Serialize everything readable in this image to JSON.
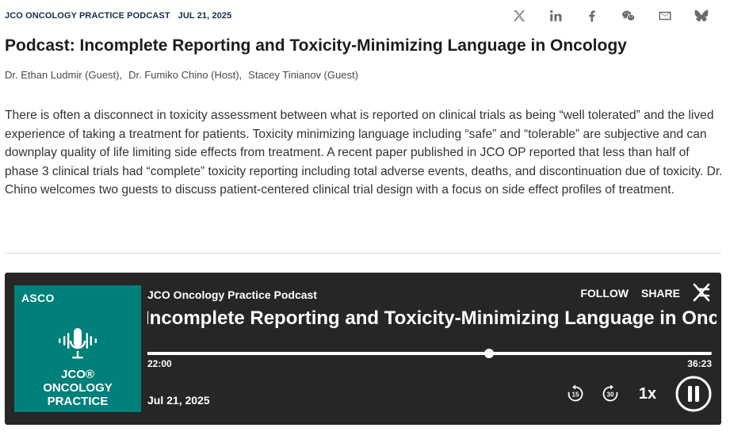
{
  "header": {
    "podcast_label": "JCO ONCOLOGY PRACTICE PODCAST",
    "date": "JUL 21, 2025"
  },
  "share_icons": [
    "x-icon",
    "linkedin-icon",
    "facebook-icon",
    "wechat-icon",
    "email-icon",
    "bluesky-icon"
  ],
  "article": {
    "title": "Podcast: Incomplete Reporting and Toxicity-Minimizing Language in Oncology",
    "authors": [
      "Dr. Ethan Ludmir (Guest),",
      "Dr. Fumiko Chino (Host),",
      "Stacey Tinianov (Guest)"
    ],
    "summary": "There is often a disconnect in toxicity assessment between what is reported on clinical trials as being “well tolerated” and the lived experience of taking a treatment for patients. Toxicity minimizing language including “safe” and “tolerable” are subjective and can downplay quality of life limiting side effects from treatment. A recent paper published in JCO OP reported that less than half of phase 3 clinical trials had “complete” toxicity reporting including total adverse events, deaths, and discontinuation due of toxicity. Dr. Chino welcomes two guests to discuss patient-centered clinical trial design with a focus on side effect profiles of treatment."
  },
  "player": {
    "cover": {
      "brand": "ASCO",
      "line1": "JCO®",
      "line2": "ONCOLOGY",
      "line3": "PRACTICE"
    },
    "show_name": "JCO Oncology Practice Podcast",
    "follow_label": "FOLLOW",
    "share_label": "SHARE",
    "episode_title": "Incomplete Reporting and Toxicity-Minimizing Language in Oncology",
    "elapsed": "22:00",
    "total": "36:23",
    "progress_fraction": 0.605,
    "publish_date": "Jul 21, 2025",
    "skip_back_seconds": "15",
    "skip_forward_seconds": "30",
    "speed": "1x",
    "state": "playing"
  }
}
